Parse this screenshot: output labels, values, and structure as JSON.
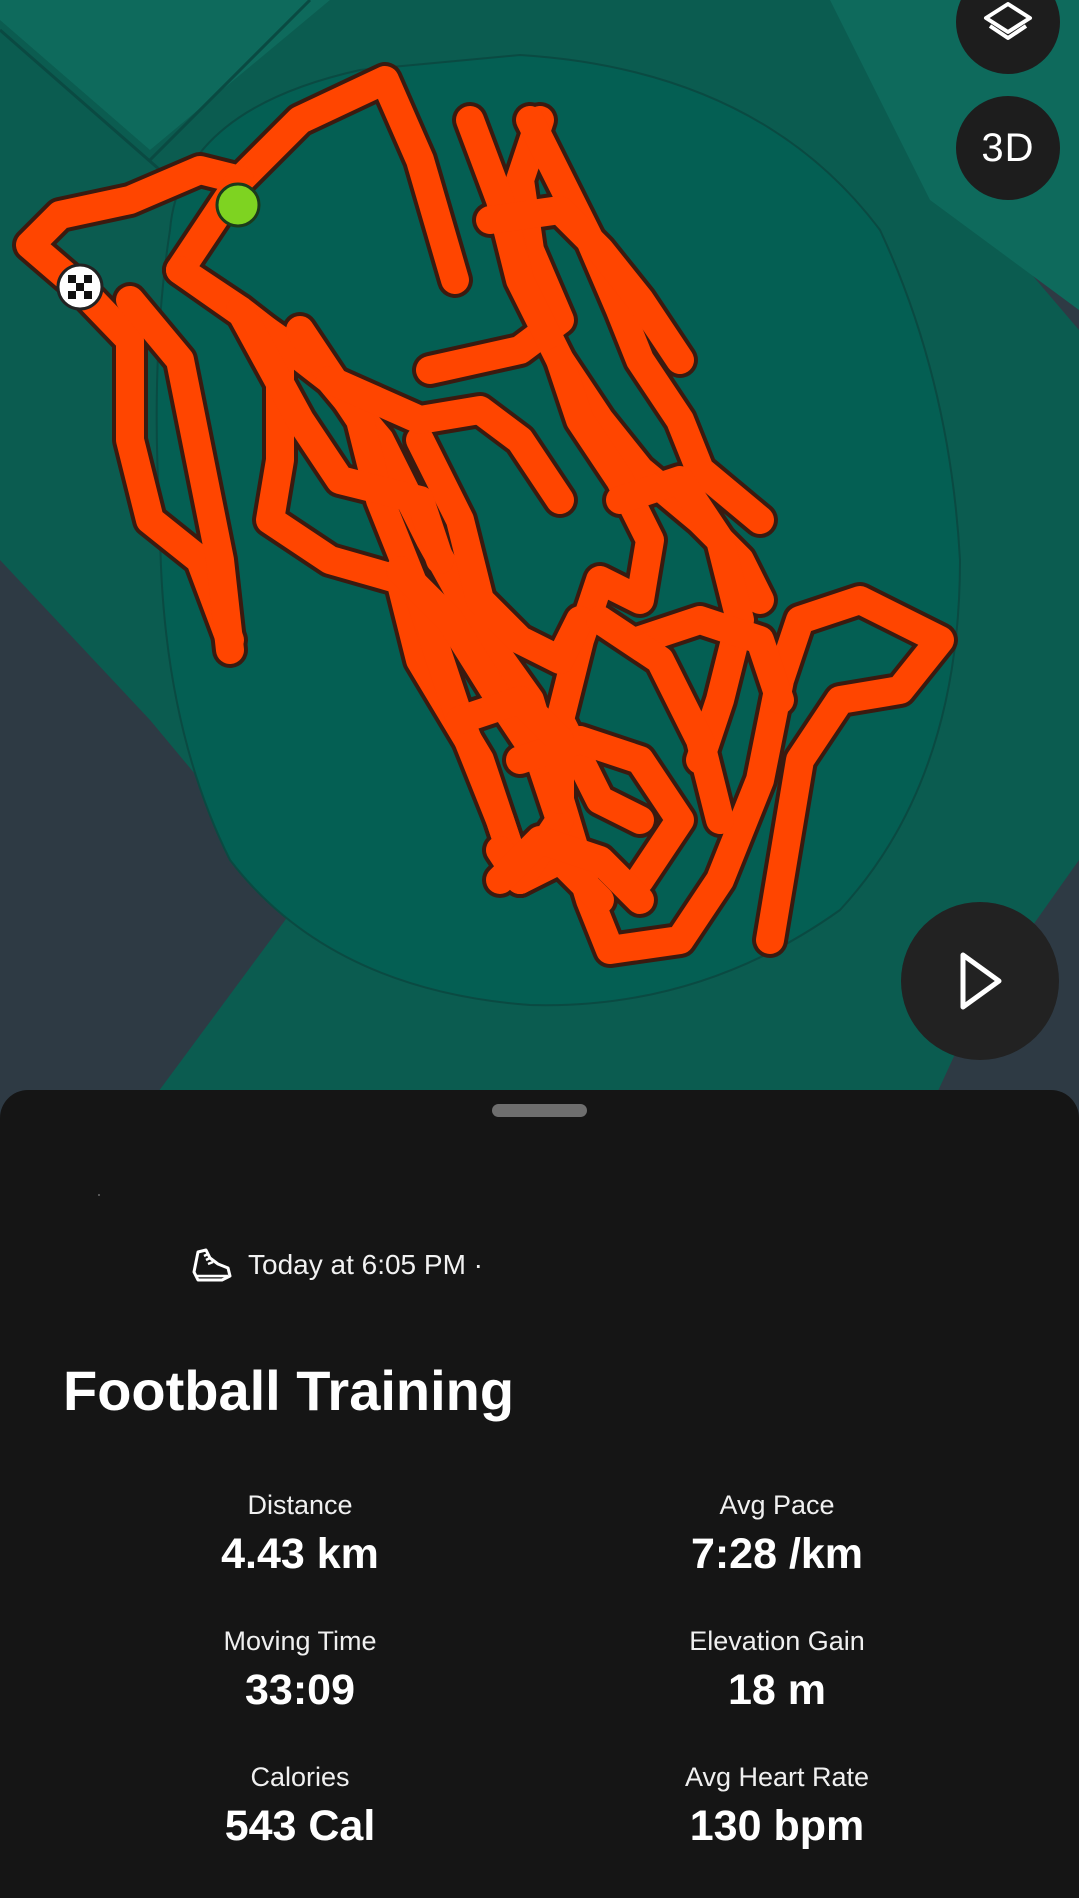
{
  "map": {
    "controls": {
      "layers_icon": "layers-icon",
      "threed_label": "3D",
      "play_icon": "play-icon"
    },
    "colors": {
      "route": "#ff4500",
      "start_marker": "#7ed321",
      "park": "#0b5c50",
      "background": "#2e3a44"
    }
  },
  "activity": {
    "sport_icon": "running-shoe-icon",
    "datetime": "Today at 6:05 PM ·",
    "title": "Football Training",
    "stats": [
      {
        "label": "Distance",
        "value": "4.43 km"
      },
      {
        "label": "Avg Pace",
        "value": "7:28 /km"
      },
      {
        "label": "Moving Time",
        "value": "33:09"
      },
      {
        "label": "Elevation Gain",
        "value": "18 m"
      },
      {
        "label": "Calories",
        "value": "543 Cal"
      },
      {
        "label": "Avg Heart Rate",
        "value": "130 bpm"
      }
    ]
  }
}
